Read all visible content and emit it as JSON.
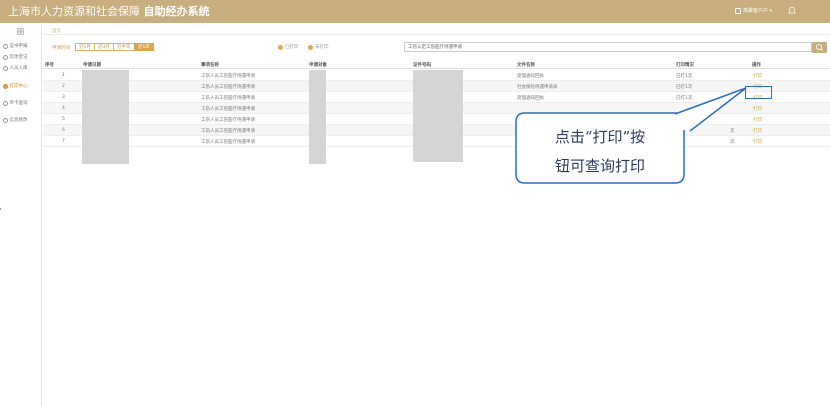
{
  "header": {
    "title_main": "上海市人力资源和社会保障",
    "title_bold": "自助经办系统",
    "user_label": "高聚客户户 ▾",
    "icons": {
      "user": "user-square-icon",
      "bell": "bell-icon"
    },
    "bg_color": "#c7ad7f"
  },
  "sidebar": {
    "items": [
      {
        "label": "证书申报",
        "icon": "circle-check-icon",
        "active": false
      },
      {
        "label": "实体登记",
        "icon": "person-icon",
        "active": false
      },
      {
        "label": "人员入库",
        "icon": "person-add-icon",
        "active": false
      },
      {
        "label": "打印中心",
        "icon": "print-icon",
        "active": true
      },
      {
        "label": "单卡查询",
        "icon": "card-icon",
        "active": false
      },
      {
        "label": "信息修改",
        "icon": "edit-icon",
        "active": false
      }
    ]
  },
  "breadcrumb": "首页",
  "filter": {
    "label": "申请时间",
    "buttons": [
      {
        "label": "近1月",
        "active": false
      },
      {
        "label": "近3月",
        "active": false
      },
      {
        "label": "近半年",
        "active": false
      },
      {
        "label": "近1年",
        "active": true
      }
    ],
    "checks": [
      "已打印",
      "未打印"
    ]
  },
  "search": {
    "value": "工伤认定工伤医疗待遇申请"
  },
  "table": {
    "headers": [
      "序号",
      "申请日期",
      "事项名称",
      "申请对象",
      "证件号码",
      "文件名称",
      "打印情况",
      "操作"
    ],
    "rows": [
      {
        "index": "1",
        "item": "工伤人员工伤医疗待遇申请",
        "doc": "受理通知回执",
        "status": "已打1次",
        "action": "打印"
      },
      {
        "index": "2",
        "item": "工伤人员工伤医疗待遇申请",
        "doc": "社会保险待遇申请表",
        "status": "已打1次",
        "action": "打印"
      },
      {
        "index": "3",
        "item": "工伤人员工伤医疗待遇申请",
        "doc": "受理通知回执",
        "status": "已打1次",
        "action": "打印"
      },
      {
        "index": "4",
        "item": "工伤人员工伤医疗待遇申请",
        "doc": "",
        "status": "",
        "action": "打印"
      },
      {
        "index": "5",
        "item": "工伤人员工伤医疗待遇申请",
        "doc": "",
        "status": "",
        "action": "打印"
      },
      {
        "index": "6",
        "item": "工伤人员工伤医疗待遇申请",
        "doc": "",
        "status": "次",
        "action": "打印"
      },
      {
        "index": "7",
        "item": "工伤人员工伤医疗待遇申请",
        "doc": "",
        "status": "次",
        "action": "打印"
      }
    ]
  },
  "callout": {
    "line1": "点击“打印”按",
    "line2": "钮可查询打印",
    "border_color": "#2d6db3"
  }
}
